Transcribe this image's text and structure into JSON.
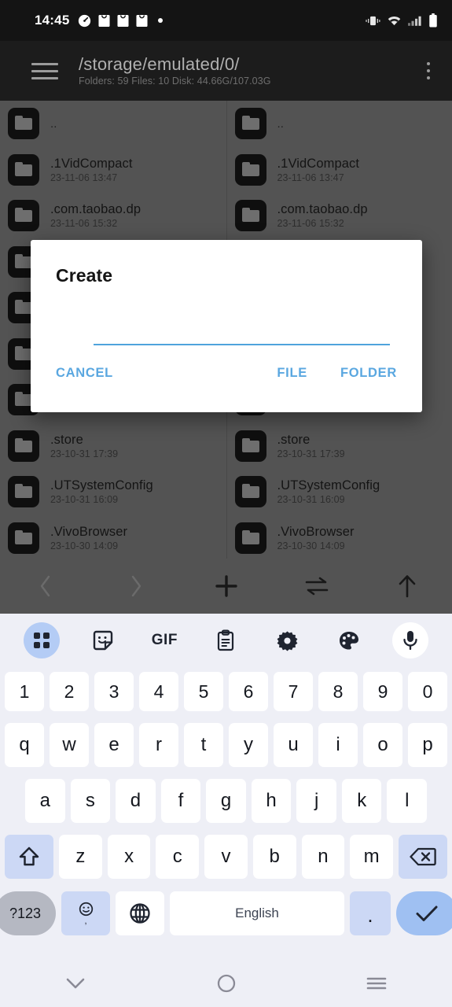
{
  "statusbar": {
    "clock": "14:45",
    "left_icons": [
      "speedometer-icon",
      "shopping-bag-icon",
      "shopping-bag-icon",
      "shopping-bag-icon",
      "dot-icon"
    ],
    "right_icons": [
      "vibrate-icon",
      "wifi-icon",
      "signal-bars-icon",
      "battery-icon"
    ]
  },
  "toolbar": {
    "menu_icon": "hamburger-icon",
    "title": "/storage/emulated/0/",
    "subtitle": "Folders: 59  Files: 10  Disk: 44.66G/107.03G",
    "overflow_icon": "kebab-menu-icon"
  },
  "panes": {
    "left": {
      "rows": [
        {
          "name": "..",
          "date": ""
        },
        {
          "name": ".1VidCompact",
          "date": "23-11-06 13:47"
        },
        {
          "name": ".com.taobao.dp",
          "date": "23-11-06 15:32"
        },
        {
          "name": "",
          "date": ""
        },
        {
          "name": "",
          "date": ""
        },
        {
          "name": "",
          "date": ""
        },
        {
          "name": "",
          "date": ""
        },
        {
          "name": ".store",
          "date": "23-10-31 17:39"
        },
        {
          "name": ".UTSystemConfig",
          "date": "23-10-31 16:09"
        },
        {
          "name": ".VivoBrowser",
          "date": "23-10-30 14:09"
        }
      ]
    },
    "right": {
      "rows": [
        {
          "name": "..",
          "date": ""
        },
        {
          "name": ".1VidCompact",
          "date": "23-11-06 13:47"
        },
        {
          "name": ".com.taobao.dp",
          "date": "23-11-06 15:32"
        },
        {
          "name": "",
          "date": ""
        },
        {
          "name": "",
          "date": ""
        },
        {
          "name": "",
          "date": ""
        },
        {
          "name": "",
          "date": ""
        },
        {
          "name": ".store",
          "date": "23-10-31 17:39"
        },
        {
          "name": ".UTSystemConfig",
          "date": "23-10-31 16:09"
        },
        {
          "name": ".VivoBrowser",
          "date": "23-10-30 14:09"
        }
      ]
    }
  },
  "actionbar": {
    "buttons": [
      {
        "icon": "chevron-left-icon",
        "enabled": false
      },
      {
        "icon": "chevron-right-icon",
        "enabled": false
      },
      {
        "icon": "plus-icon",
        "enabled": true
      },
      {
        "icon": "swap-arrows-icon",
        "enabled": true
      },
      {
        "icon": "arrow-up-icon",
        "enabled": true
      }
    ]
  },
  "dialog": {
    "title": "Create",
    "input_value": "",
    "input_placeholder": "",
    "cancel_label": "CANCEL",
    "file_label": "FILE",
    "folder_label": "FOLDER",
    "accent_color": "#5aa7e0",
    "underline_color": "#4fa3dc"
  },
  "keyboard": {
    "toolbar_icons": [
      "apps-grid-icon",
      "sticker-icon",
      "gif-icon",
      "clipboard-icon",
      "gear-icon",
      "palette-icon",
      "microphone-icon"
    ],
    "gif_label": "GIF",
    "row_numbers": [
      "1",
      "2",
      "3",
      "4",
      "5",
      "6",
      "7",
      "8",
      "9",
      "0"
    ],
    "row_top": [
      "q",
      "w",
      "e",
      "r",
      "t",
      "y",
      "u",
      "i",
      "o",
      "p"
    ],
    "row_home": [
      "a",
      "s",
      "d",
      "f",
      "g",
      "h",
      "j",
      "k",
      "l"
    ],
    "row_bottom": [
      "z",
      "x",
      "c",
      "v",
      "b",
      "n",
      "m"
    ],
    "shift_icon": "shift-up-arrow-icon",
    "backspace_icon": "backspace-icon",
    "symbols_label": "?123",
    "emoji_icon": "emoji-smiley-icon",
    "comma_label": ",",
    "globe_icon": "globe-language-icon",
    "space_label": "English",
    "period_label": ".",
    "enter_icon": "checkmark-icon",
    "key_bg": "#ffffff",
    "board_bg": "#eeeff6",
    "accent_key_bg": "#ccd8f5"
  },
  "navbar": {
    "back_icon": "chevron-down-icon",
    "home_icon": "circle-home-icon",
    "recents_icon": "hamburger-recents-icon"
  }
}
